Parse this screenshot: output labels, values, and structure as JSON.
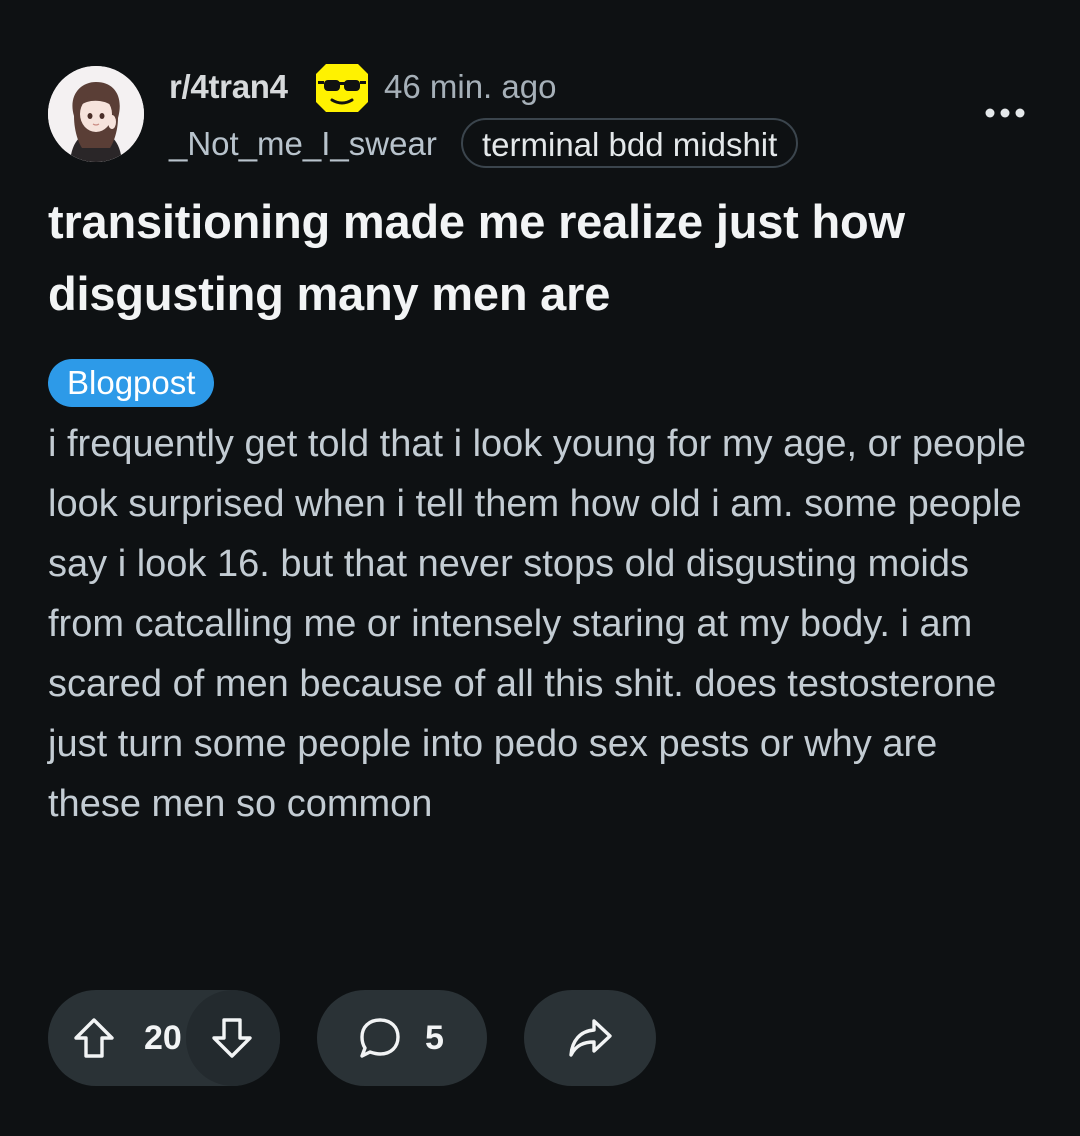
{
  "post": {
    "subreddit": "r/4tran4",
    "time_ago": "46 min. ago",
    "author": "_Not_me_I_swear",
    "user_flair": "terminal bdd midshit",
    "title": "transitioning made me realize just how disgusting many men are",
    "post_flair": "Blogpost",
    "body": "i frequently get told that i look young for my age, or people look surprised when i tell them how old i am. some people say i look 16. but that never stops old disgusting moids from catcalling me or intensely staring at my body. i am scared of men because of all this shit. does testosterone just turn some people into pedo sex pests or why are these men so common",
    "post_flair_color": "#2d9ae8"
  },
  "actions": {
    "vote_count": "20",
    "comment_count": "5"
  },
  "icons": {
    "avatar": "anime-avatar",
    "subreddit": "sunglasses-face-icon",
    "more": "more-options-icon",
    "upvote": "upvote-arrow-icon",
    "downvote": "downvote-arrow-icon",
    "comment": "comment-bubble-icon",
    "share": "share-arrow-icon"
  }
}
